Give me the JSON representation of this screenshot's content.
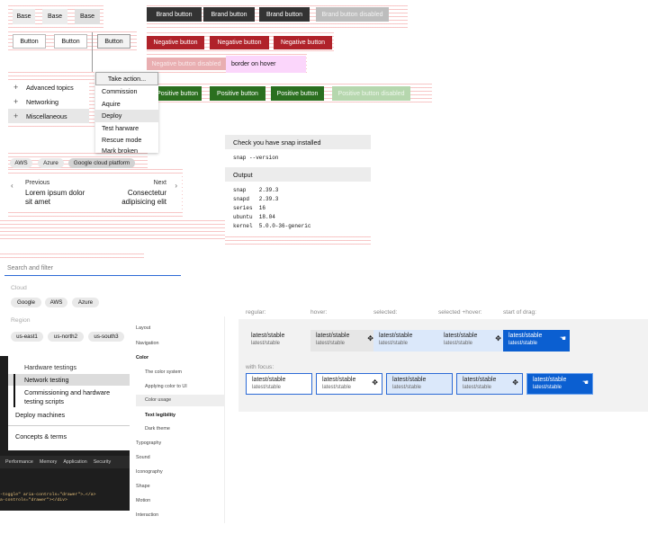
{
  "buttons": {
    "base": [
      "Base",
      "Base",
      "Base"
    ],
    "outline": [
      "Button",
      "Button",
      "Button"
    ],
    "brand": [
      "Brand button",
      "Brand button",
      "Brand button",
      "Brand button disabled"
    ],
    "negative": [
      "Negative button",
      "Negative button",
      "Negative button",
      "Negative button disabled"
    ],
    "positive": [
      "Positive button",
      "Positive button",
      "Positive button",
      "Positive button disabled"
    ],
    "hover_tooltip": "border on hover"
  },
  "side_nav": {
    "items": [
      {
        "label": "Advanced topics",
        "icon": "plus-icon"
      },
      {
        "label": "Networking",
        "icon": "plus-icon"
      },
      {
        "label": "Miscellaneous",
        "icon": "plus-icon"
      }
    ]
  },
  "menu": {
    "toggle": "Take action...",
    "items": [
      "Commission",
      "Aquire",
      "Deploy",
      "Test harware",
      "Rescue mode",
      "Mark broken"
    ]
  },
  "chips": [
    "AWS",
    "Azure",
    "Google cloud platform"
  ],
  "pagination": {
    "prev_label": "Previous",
    "prev_title": "Lorem ipsum dolor sit amet",
    "next_label": "Next",
    "next_title": "Consectetur adipisicing elit"
  },
  "snap": {
    "header": "Check you have snap installed",
    "command": "snap --version",
    "output_header": "Output",
    "output": "snap    2.39.3\nsnapd   2.39.3\nseries  16\nubuntu  18.04\nkernel  5.0.0-36-generic"
  },
  "search": {
    "placeholder": "Search and filter",
    "groups": [
      {
        "label": "Cloud",
        "items": [
          "Google",
          "AWS",
          "Azure"
        ]
      },
      {
        "label": "Region",
        "items": [
          "us-east1",
          "us-north2",
          "us-south3"
        ]
      }
    ]
  },
  "docs_nav": {
    "items": [
      "Hardware testings",
      "Network testing",
      "Commissioning and hardware testing scripts",
      "Deploy machines",
      "Concepts & terms"
    ]
  },
  "devtools": {
    "tabs": [
      "Performance",
      "Memory",
      "Application",
      "Security"
    ],
    "code": [
      "-toggle\" aria-controls=\"drawer\">…</a>",
      "a-controls=\"drawer\"></div>"
    ]
  },
  "topic_nav": {
    "items": [
      "Layout",
      "Navigation",
      "Color",
      "The color system",
      "Applying color to UI",
      "Color usage",
      "Text legibility",
      "Dark theme",
      "Typography",
      "Sound",
      "Iconography",
      "Shape",
      "Motion",
      "Interaction"
    ]
  },
  "tab_states": {
    "labels": [
      "regular:",
      "hover:",
      "selected:",
      "selected +hover:",
      "start of drag:"
    ],
    "focus_label": "with focus:",
    "card_title": "latest/stable",
    "card_sub": "latest/stable"
  }
}
